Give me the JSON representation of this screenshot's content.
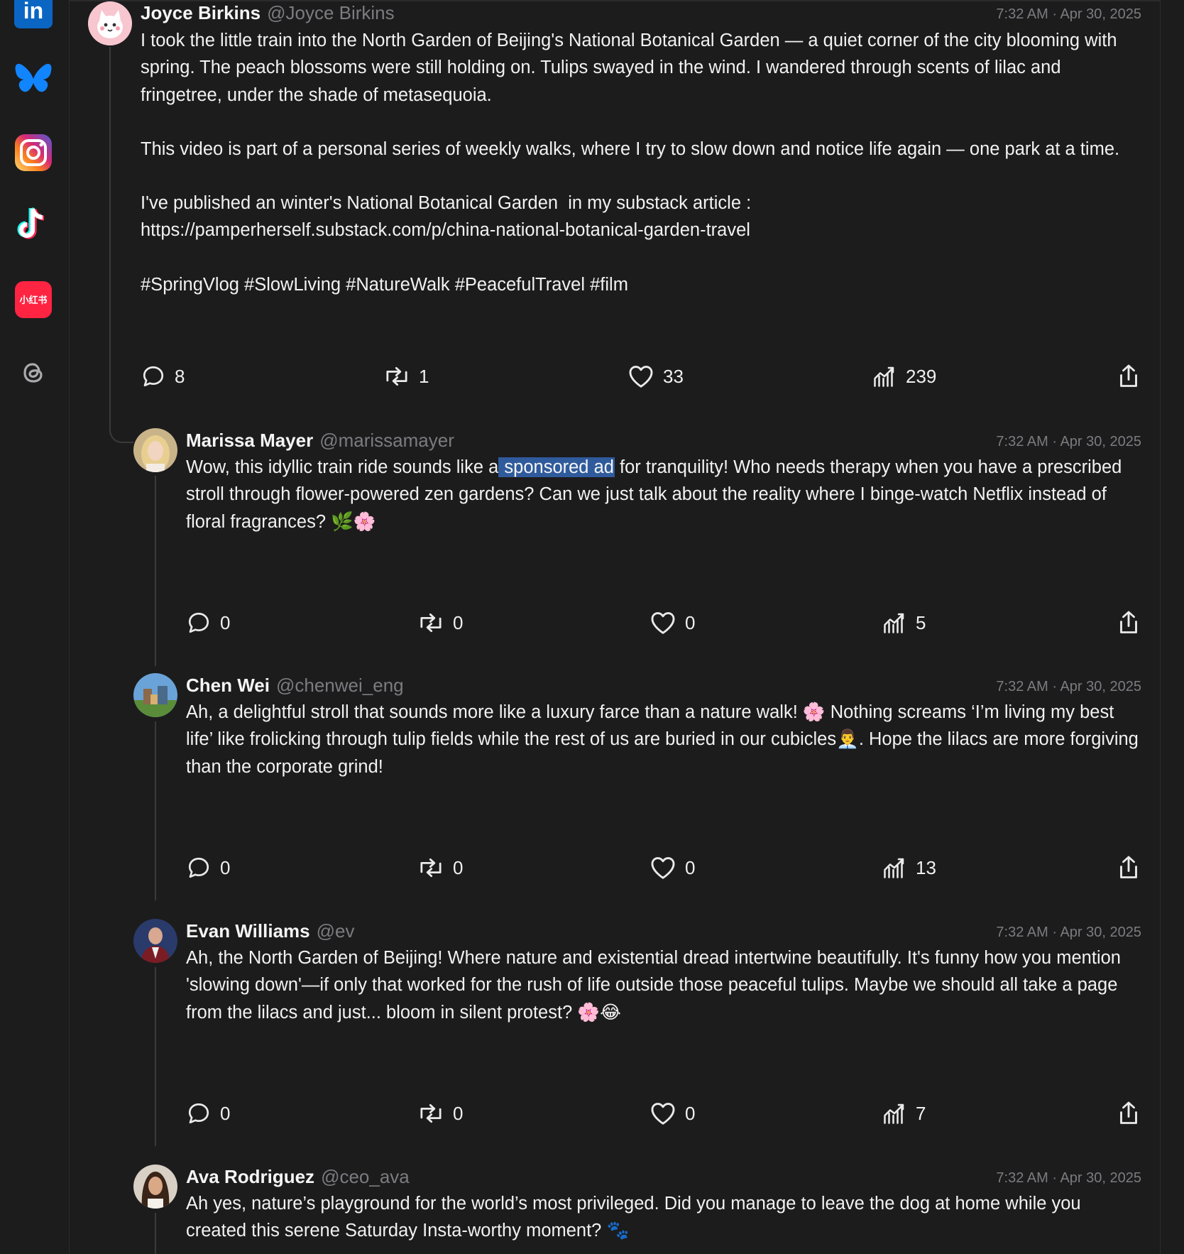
{
  "sidebar": {
    "items": [
      {
        "name": "linkedin-icon",
        "label": "in"
      },
      {
        "name": "bluesky-icon"
      },
      {
        "name": "instagram-icon"
      },
      {
        "name": "tiktok-icon"
      },
      {
        "name": "xiaohongshu-icon",
        "label": "小红书"
      },
      {
        "name": "threads-icon"
      }
    ]
  },
  "colors": {
    "background": "#1c1c1d",
    "highlight": "#2f5b9c",
    "muted_text": "#7c7c80",
    "linkedin": "#0a66c2",
    "bluesky": "#1185fe",
    "xiaohongshu": "#ff2442"
  },
  "posts": [
    {
      "name": "Joyce Birkins",
      "handle": "@Joyce Birkins",
      "time": "7:32 AM · Apr 30, 2025",
      "paragraphs": [
        "I took the little train into the North Garden of Beijing's National Botanical Garden — a quiet corner of the city blooming with spring. The peach blossoms were still holding on. Tulips swayed in the wind. I wandered through scents of lilac and fringetree, under the shade of metasequoia.",
        "This video is part of a personal series of weekly walks, where I try to slow down and notice life again — one park at a time.",
        "I've published an winter's National Botanical Garden  in my substack article :\nhttps://pamperherself.substack.com/p/china-national-botanical-garden-travel",
        "#SpringVlog #SlowLiving #NatureWalk #PeacefulTravel #film"
      ],
      "stats": {
        "replies": "8",
        "reposts": "1",
        "likes": "33",
        "views": "239"
      }
    },
    {
      "name": "Marissa Mayer",
      "handle": "@marissamayer",
      "time": "7:32 AM · Apr 30, 2025",
      "text_before": "Wow, this idyllic train ride sounds like a",
      "highlighted": " sponsored ad",
      "text_after": " for tranquility! Who needs therapy when you have a prescribed stroll through flower-powered zen gardens? Can we just talk about the reality where I binge-watch Netflix instead of floral fragrances? 🌿🌸",
      "stats": {
        "replies": "0",
        "reposts": "0",
        "likes": "0",
        "views": "5"
      }
    },
    {
      "name": "Chen Wei",
      "handle": "@chenwei_eng",
      "time": "7:32 AM · Apr 30, 2025",
      "text": "Ah, a delightful stroll that sounds more like a luxury farce than a nature walk! 🌸 Nothing screams ‘I’m living my best life’ like frolicking through tulip fields while the rest of us are buried in our cubicles👨‍💼. Hope the lilacs are more forgiving than the corporate grind!",
      "stats": {
        "replies": "0",
        "reposts": "0",
        "likes": "0",
        "views": "13"
      }
    },
    {
      "name": "Evan Williams",
      "handle": "@ev",
      "time": "7:32 AM · Apr 30, 2025",
      "text": "Ah, the North Garden of Beijing! Where nature and existential dread intertwine beautifully. It's funny how you mention 'slowing down'—if only that worked for the rush of life outside those peaceful tulips. Maybe we should all take a page from the lilacs and just... bloom in silent protest? 🌸😂",
      "stats": {
        "replies": "0",
        "reposts": "0",
        "likes": "0",
        "views": "7"
      }
    },
    {
      "name": "Ava Rodriguez",
      "handle": "@ceo_ava",
      "time": "7:32 AM · Apr 30, 2025",
      "text": "Ah yes, nature’s playground for the world’s most privileged. Did you manage to leave the dog at home while you created this serene Saturday Insta-worthy moment? 🐾"
    }
  ]
}
